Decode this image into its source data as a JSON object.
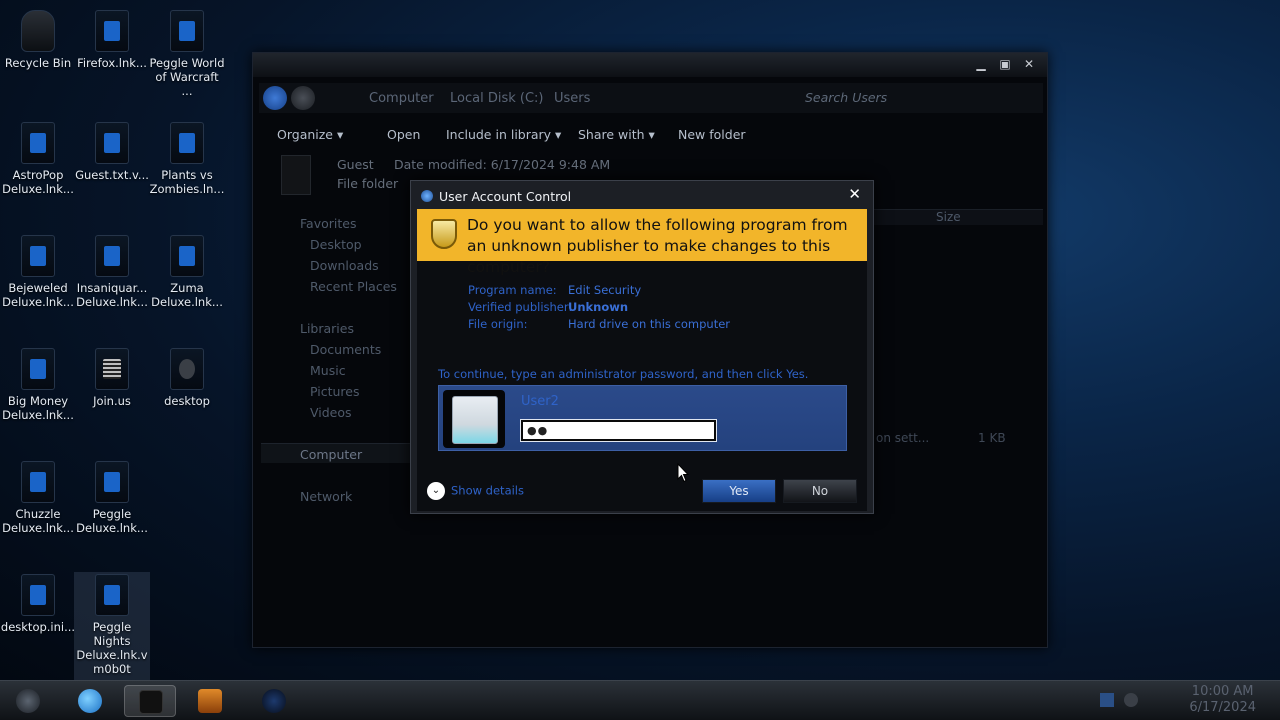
{
  "desktop": {
    "icons": [
      {
        "label": "Recycle Bin",
        "kind": "bin"
      },
      {
        "label": "Firefox.lnk...",
        "kind": "app"
      },
      {
        "label": "Peggle World of Warcraft ...",
        "kind": "app"
      },
      {
        "label": "AstroPop Deluxe.lnk...",
        "kind": "app"
      },
      {
        "label": "Guest.txt.v...",
        "kind": "app"
      },
      {
        "label": "Plants vs Zombies.ln...",
        "kind": "app"
      },
      {
        "label": "Bejeweled Deluxe.lnk...",
        "kind": "app"
      },
      {
        "label": "Insaniquar... Deluxe.lnk...",
        "kind": "app"
      },
      {
        "label": "Zuma Deluxe.lnk...",
        "kind": "app"
      },
      {
        "label": "Big Money Deluxe.lnk...",
        "kind": "app"
      },
      {
        "label": "Join.us",
        "kind": "doc"
      },
      {
        "label": "desktop",
        "kind": "gear"
      },
      {
        "label": "Chuzzle Deluxe.lnk...",
        "kind": "app"
      },
      {
        "label": "Peggle Deluxe.lnk...",
        "kind": "app"
      },
      {
        "label": "desktop.ini...",
        "kind": "app"
      },
      {
        "label": "Peggle Nights Deluxe.lnk.v m0b0t",
        "kind": "app"
      }
    ]
  },
  "explorer": {
    "window_controls": {
      "minimize": "▁",
      "maximize": "▣",
      "close": "✕"
    },
    "breadcrumb": [
      "Computer",
      "Local Disk (C:)",
      "Users"
    ],
    "search_placeholder": "Search Users",
    "toolbar": {
      "organize": "Organize ▾",
      "open": "Open",
      "include": "Include in library ▾",
      "share": "Share with ▾",
      "new_folder": "New folder"
    },
    "details_pane": {
      "name": "Guest",
      "date_label": "Date modified: 6/17/2024 9:48 AM",
      "type": "File folder"
    },
    "column_size": "Size",
    "file_row_fragment": "on sett...",
    "file_row_size": "1 KB",
    "nav": {
      "favorites": "Favorites",
      "desktop": "Desktop",
      "downloads": "Downloads",
      "recent": "Recent Places",
      "libraries": "Libraries",
      "documents": "Documents",
      "music": "Music",
      "pictures": "Pictures",
      "videos": "Videos",
      "computer": "Computer",
      "network": "Network"
    }
  },
  "uac": {
    "title": "User Account Control",
    "close": "✕",
    "question": "Do you want to allow the following program from an unknown publisher to make changes to this computer?",
    "program_name_label": "Program name:",
    "program_name_value": "Edit Security",
    "publisher_label": "Verified publisher:",
    "publisher_value": "Unknown",
    "origin_label": "File origin:",
    "origin_value": "Hard drive on this computer",
    "instruction": "To continue, type an administrator password, and then click Yes.",
    "username": "User2",
    "password_mask": "●●",
    "show_details": "Show details",
    "yes": "Yes",
    "no": "No"
  },
  "taskbar": {
    "time": "10:00 AM",
    "date": "6/17/2024"
  },
  "colors": {
    "banner": "#f2b52a",
    "link_blue": "#2f63c9",
    "credential_bg": "#2b4a8a"
  }
}
